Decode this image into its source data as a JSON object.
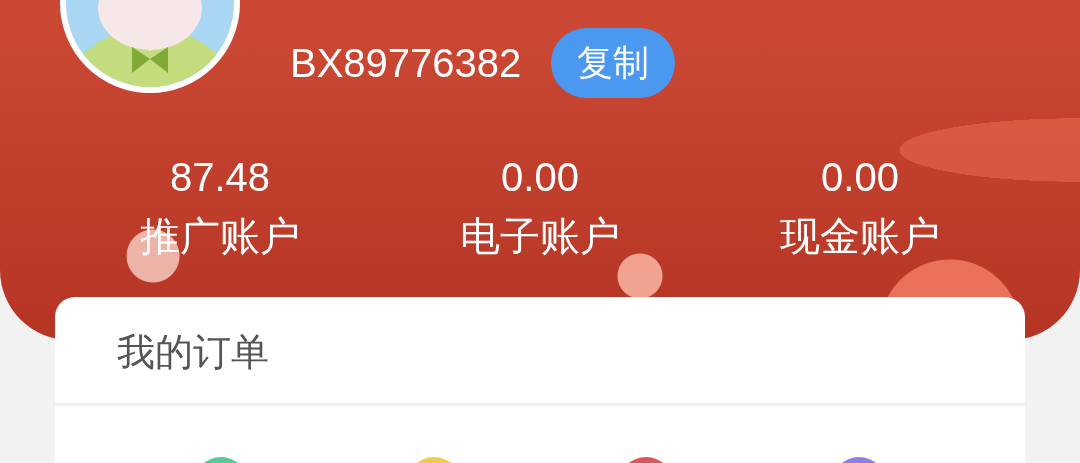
{
  "profile": {
    "user_id": "BX89776382",
    "copy_button": "复制"
  },
  "accounts": [
    {
      "amount": "87.48",
      "label": "推广账户"
    },
    {
      "amount": "0.00",
      "label": "电子账户"
    },
    {
      "amount": "0.00",
      "label": "现金账户"
    }
  ],
  "orders_card": {
    "title": "我的订单",
    "icons": [
      {
        "color": "#5cc896"
      },
      {
        "color": "#f2c94c"
      },
      {
        "color": "#e0555a"
      },
      {
        "color": "#8f7ee6"
      }
    ]
  }
}
